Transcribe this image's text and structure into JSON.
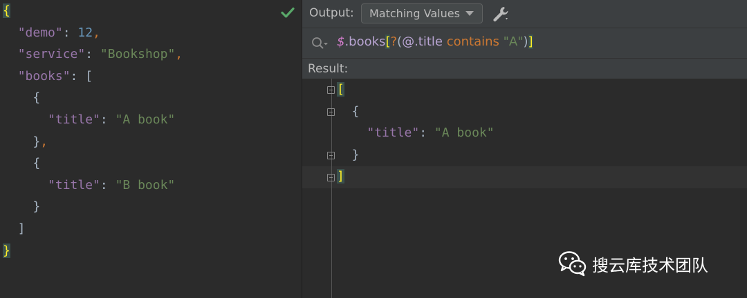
{
  "left_editor": {
    "lines": [
      [
        {
          "t": "{",
          "c": "brace-hl"
        }
      ],
      [
        {
          "t": "  "
        },
        {
          "t": "\"demo\"",
          "c": "tok-key"
        },
        {
          "t": ": "
        },
        {
          "t": "12",
          "c": "tok-num"
        },
        {
          "t": ",",
          "c": "tok-punc"
        }
      ],
      [
        {
          "t": "  "
        },
        {
          "t": "\"service\"",
          "c": "tok-key"
        },
        {
          "t": ": "
        },
        {
          "t": "\"Bookshop\"",
          "c": "tok-str"
        },
        {
          "t": ",",
          "c": "tok-punc"
        }
      ],
      [
        {
          "t": "  "
        },
        {
          "t": "\"books\"",
          "c": "tok-key"
        },
        {
          "t": ": ["
        }
      ],
      [
        {
          "t": "    {"
        }
      ],
      [
        {
          "t": "      "
        },
        {
          "t": "\"title\"",
          "c": "tok-key"
        },
        {
          "t": ": "
        },
        {
          "t": "\"A book\"",
          "c": "tok-str"
        }
      ],
      [
        {
          "t": "    }"
        },
        {
          "t": ",",
          "c": "tok-punc"
        }
      ],
      [
        {
          "t": "    {"
        }
      ],
      [
        {
          "t": "      "
        },
        {
          "t": "\"title\"",
          "c": "tok-key"
        },
        {
          "t": ": "
        },
        {
          "t": "\"B book\"",
          "c": "tok-str"
        }
      ],
      [
        {
          "t": "    }"
        }
      ],
      [
        {
          "t": "  ]"
        }
      ],
      [
        {
          "t": "}",
          "c": "brace-hl"
        }
      ]
    ]
  },
  "toolbar": {
    "output_label": "Output:",
    "dropdown_value": "Matching Values",
    "settings_icon": "wrench-icon"
  },
  "search": {
    "icon": "search-icon",
    "query_parts": [
      {
        "t": "$",
        "c": "q-dollar"
      },
      {
        "t": ".books",
        "c": "q-path"
      },
      {
        "t": "[",
        "c": "q-bracket"
      },
      {
        "t": "?",
        "c": "q-punc"
      },
      {
        "t": "(",
        "c": "q-paren"
      },
      {
        "t": "@.title",
        "c": "q-at"
      },
      {
        "t": " contains ",
        "c": "q-kw"
      },
      {
        "t": "\"A\"",
        "c": "q-str"
      },
      {
        "t": ")",
        "c": "q-paren"
      },
      {
        "t": "]",
        "c": "q-bracket"
      }
    ]
  },
  "result": {
    "label": "Result:",
    "lines": [
      [
        {
          "t": "[",
          "c": "brace-hl"
        }
      ],
      [
        {
          "t": "  {"
        }
      ],
      [
        {
          "t": "    "
        },
        {
          "t": "\"title\"",
          "c": "tok-key"
        },
        {
          "t": ": "
        },
        {
          "t": "\"A book\"",
          "c": "tok-str"
        }
      ],
      [
        {
          "t": "  }"
        }
      ],
      [
        {
          "t": "]",
          "c": "brace-hl"
        }
      ]
    ]
  },
  "status": {
    "editor_check_icon": "check-icon"
  },
  "watermark": {
    "icon": "wechat-icon",
    "text": "搜云库技术团队"
  },
  "colors": {
    "background": "#2b2b2b",
    "panel": "#3c3f41",
    "json_key": "#9876aa",
    "json_string": "#6a8759",
    "json_number": "#6897bb",
    "brace_highlight": "#ffef28",
    "check": "#59a869"
  }
}
